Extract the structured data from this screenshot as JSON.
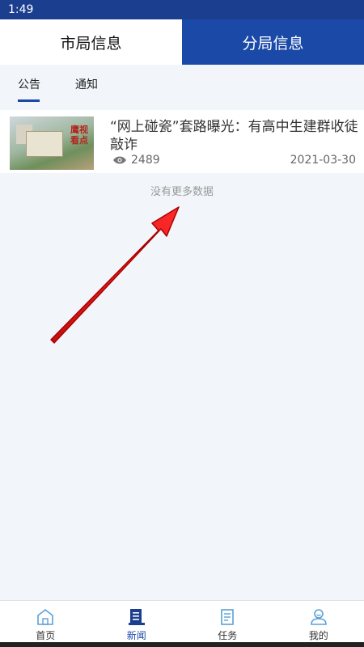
{
  "status": {
    "time": "1:49"
  },
  "top_tabs": [
    {
      "label": "市局信息",
      "active": false
    },
    {
      "label": "分局信息",
      "active": true
    }
  ],
  "sub_tabs": [
    {
      "label": "公告",
      "active": true
    },
    {
      "label": "通知",
      "active": false
    }
  ],
  "news": [
    {
      "title": "“网上碰瓷”套路曝光：有高中生建群收徒敲诈",
      "views": "2489",
      "date": "2021-03-30",
      "thumb_text": "鹰视看点"
    }
  ],
  "no_more": "没有更多数据",
  "bottom_nav": [
    {
      "label": "首页",
      "icon": "home-icon",
      "active": false
    },
    {
      "label": "新闻",
      "icon": "news-icon",
      "active": true
    },
    {
      "label": "任务",
      "icon": "task-icon",
      "active": false
    },
    {
      "label": "我的",
      "icon": "profile-icon",
      "active": false
    }
  ],
  "colors": {
    "primary": "#1b49a8",
    "status_bar": "#1b3e8f",
    "background": "#f2f6fa",
    "arrow": "#e01b1b"
  }
}
